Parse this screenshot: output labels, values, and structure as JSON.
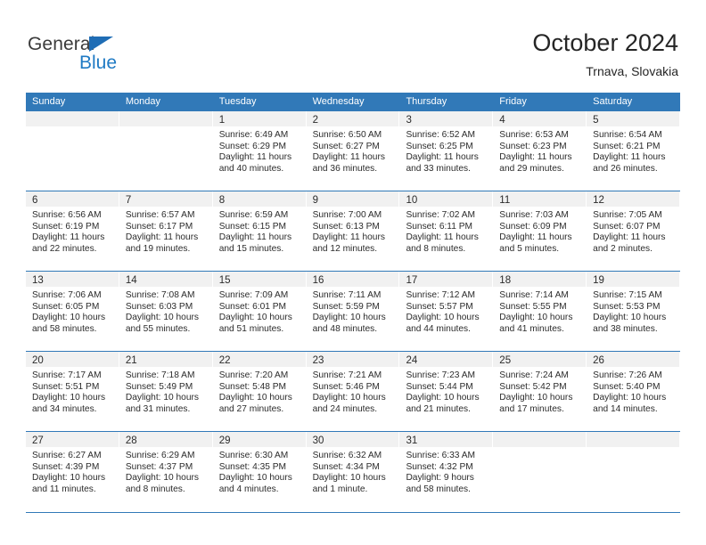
{
  "brand": {
    "name_part1": "General",
    "name_part2": "Blue",
    "triangle_icon": "triangle-icon",
    "color_dark": "#3b3b3b",
    "color_blue": "#1f7ac4"
  },
  "header": {
    "title": "October 2024",
    "subtitle": "Trnava, Slovakia"
  },
  "theme": {
    "header_blue": "#3179b8",
    "date_band_gray": "#f1f1f1",
    "text": "#2b2b2b"
  },
  "labels": {
    "sunrise_prefix": "Sunrise:",
    "sunset_prefix": "Sunset:",
    "daylight_prefix": "Daylight:"
  },
  "weekdays": [
    "Sunday",
    "Monday",
    "Tuesday",
    "Wednesday",
    "Thursday",
    "Friday",
    "Saturday"
  ],
  "weeks": [
    [
      {
        "day": ""
      },
      {
        "day": ""
      },
      {
        "day": "1",
        "sunrise": "Sunrise: 6:49 AM",
        "sunset": "Sunset: 6:29 PM",
        "daylight_l1": "Daylight: 11 hours",
        "daylight_l2": "and 40 minutes."
      },
      {
        "day": "2",
        "sunrise": "Sunrise: 6:50 AM",
        "sunset": "Sunset: 6:27 PM",
        "daylight_l1": "Daylight: 11 hours",
        "daylight_l2": "and 36 minutes."
      },
      {
        "day": "3",
        "sunrise": "Sunrise: 6:52 AM",
        "sunset": "Sunset: 6:25 PM",
        "daylight_l1": "Daylight: 11 hours",
        "daylight_l2": "and 33 minutes."
      },
      {
        "day": "4",
        "sunrise": "Sunrise: 6:53 AM",
        "sunset": "Sunset: 6:23 PM",
        "daylight_l1": "Daylight: 11 hours",
        "daylight_l2": "and 29 minutes."
      },
      {
        "day": "5",
        "sunrise": "Sunrise: 6:54 AM",
        "sunset": "Sunset: 6:21 PM",
        "daylight_l1": "Daylight: 11 hours",
        "daylight_l2": "and 26 minutes."
      }
    ],
    [
      {
        "day": "6",
        "sunrise": "Sunrise: 6:56 AM",
        "sunset": "Sunset: 6:19 PM",
        "daylight_l1": "Daylight: 11 hours",
        "daylight_l2": "and 22 minutes."
      },
      {
        "day": "7",
        "sunrise": "Sunrise: 6:57 AM",
        "sunset": "Sunset: 6:17 PM",
        "daylight_l1": "Daylight: 11 hours",
        "daylight_l2": "and 19 minutes."
      },
      {
        "day": "8",
        "sunrise": "Sunrise: 6:59 AM",
        "sunset": "Sunset: 6:15 PM",
        "daylight_l1": "Daylight: 11 hours",
        "daylight_l2": "and 15 minutes."
      },
      {
        "day": "9",
        "sunrise": "Sunrise: 7:00 AM",
        "sunset": "Sunset: 6:13 PM",
        "daylight_l1": "Daylight: 11 hours",
        "daylight_l2": "and 12 minutes."
      },
      {
        "day": "10",
        "sunrise": "Sunrise: 7:02 AM",
        "sunset": "Sunset: 6:11 PM",
        "daylight_l1": "Daylight: 11 hours",
        "daylight_l2": "and 8 minutes."
      },
      {
        "day": "11",
        "sunrise": "Sunrise: 7:03 AM",
        "sunset": "Sunset: 6:09 PM",
        "daylight_l1": "Daylight: 11 hours",
        "daylight_l2": "and 5 minutes."
      },
      {
        "day": "12",
        "sunrise": "Sunrise: 7:05 AM",
        "sunset": "Sunset: 6:07 PM",
        "daylight_l1": "Daylight: 11 hours",
        "daylight_l2": "and 2 minutes."
      }
    ],
    [
      {
        "day": "13",
        "sunrise": "Sunrise: 7:06 AM",
        "sunset": "Sunset: 6:05 PM",
        "daylight_l1": "Daylight: 10 hours",
        "daylight_l2": "and 58 minutes."
      },
      {
        "day": "14",
        "sunrise": "Sunrise: 7:08 AM",
        "sunset": "Sunset: 6:03 PM",
        "daylight_l1": "Daylight: 10 hours",
        "daylight_l2": "and 55 minutes."
      },
      {
        "day": "15",
        "sunrise": "Sunrise: 7:09 AM",
        "sunset": "Sunset: 6:01 PM",
        "daylight_l1": "Daylight: 10 hours",
        "daylight_l2": "and 51 minutes."
      },
      {
        "day": "16",
        "sunrise": "Sunrise: 7:11 AM",
        "sunset": "Sunset: 5:59 PM",
        "daylight_l1": "Daylight: 10 hours",
        "daylight_l2": "and 48 minutes."
      },
      {
        "day": "17",
        "sunrise": "Sunrise: 7:12 AM",
        "sunset": "Sunset: 5:57 PM",
        "daylight_l1": "Daylight: 10 hours",
        "daylight_l2": "and 44 minutes."
      },
      {
        "day": "18",
        "sunrise": "Sunrise: 7:14 AM",
        "sunset": "Sunset: 5:55 PM",
        "daylight_l1": "Daylight: 10 hours",
        "daylight_l2": "and 41 minutes."
      },
      {
        "day": "19",
        "sunrise": "Sunrise: 7:15 AM",
        "sunset": "Sunset: 5:53 PM",
        "daylight_l1": "Daylight: 10 hours",
        "daylight_l2": "and 38 minutes."
      }
    ],
    [
      {
        "day": "20",
        "sunrise": "Sunrise: 7:17 AM",
        "sunset": "Sunset: 5:51 PM",
        "daylight_l1": "Daylight: 10 hours",
        "daylight_l2": "and 34 minutes."
      },
      {
        "day": "21",
        "sunrise": "Sunrise: 7:18 AM",
        "sunset": "Sunset: 5:49 PM",
        "daylight_l1": "Daylight: 10 hours",
        "daylight_l2": "and 31 minutes."
      },
      {
        "day": "22",
        "sunrise": "Sunrise: 7:20 AM",
        "sunset": "Sunset: 5:48 PM",
        "daylight_l1": "Daylight: 10 hours",
        "daylight_l2": "and 27 minutes."
      },
      {
        "day": "23",
        "sunrise": "Sunrise: 7:21 AM",
        "sunset": "Sunset: 5:46 PM",
        "daylight_l1": "Daylight: 10 hours",
        "daylight_l2": "and 24 minutes."
      },
      {
        "day": "24",
        "sunrise": "Sunrise: 7:23 AM",
        "sunset": "Sunset: 5:44 PM",
        "daylight_l1": "Daylight: 10 hours",
        "daylight_l2": "and 21 minutes."
      },
      {
        "day": "25",
        "sunrise": "Sunrise: 7:24 AM",
        "sunset": "Sunset: 5:42 PM",
        "daylight_l1": "Daylight: 10 hours",
        "daylight_l2": "and 17 minutes."
      },
      {
        "day": "26",
        "sunrise": "Sunrise: 7:26 AM",
        "sunset": "Sunset: 5:40 PM",
        "daylight_l1": "Daylight: 10 hours",
        "daylight_l2": "and 14 minutes."
      }
    ],
    [
      {
        "day": "27",
        "sunrise": "Sunrise: 6:27 AM",
        "sunset": "Sunset: 4:39 PM",
        "daylight_l1": "Daylight: 10 hours",
        "daylight_l2": "and 11 minutes."
      },
      {
        "day": "28",
        "sunrise": "Sunrise: 6:29 AM",
        "sunset": "Sunset: 4:37 PM",
        "daylight_l1": "Daylight: 10 hours",
        "daylight_l2": "and 8 minutes."
      },
      {
        "day": "29",
        "sunrise": "Sunrise: 6:30 AM",
        "sunset": "Sunset: 4:35 PM",
        "daylight_l1": "Daylight: 10 hours",
        "daylight_l2": "and 4 minutes."
      },
      {
        "day": "30",
        "sunrise": "Sunrise: 6:32 AM",
        "sunset": "Sunset: 4:34 PM",
        "daylight_l1": "Daylight: 10 hours",
        "daylight_l2": "and 1 minute."
      },
      {
        "day": "31",
        "sunrise": "Sunrise: 6:33 AM",
        "sunset": "Sunset: 4:32 PM",
        "daylight_l1": "Daylight: 9 hours",
        "daylight_l2": "and 58 minutes."
      },
      {
        "day": ""
      },
      {
        "day": ""
      }
    ]
  ]
}
